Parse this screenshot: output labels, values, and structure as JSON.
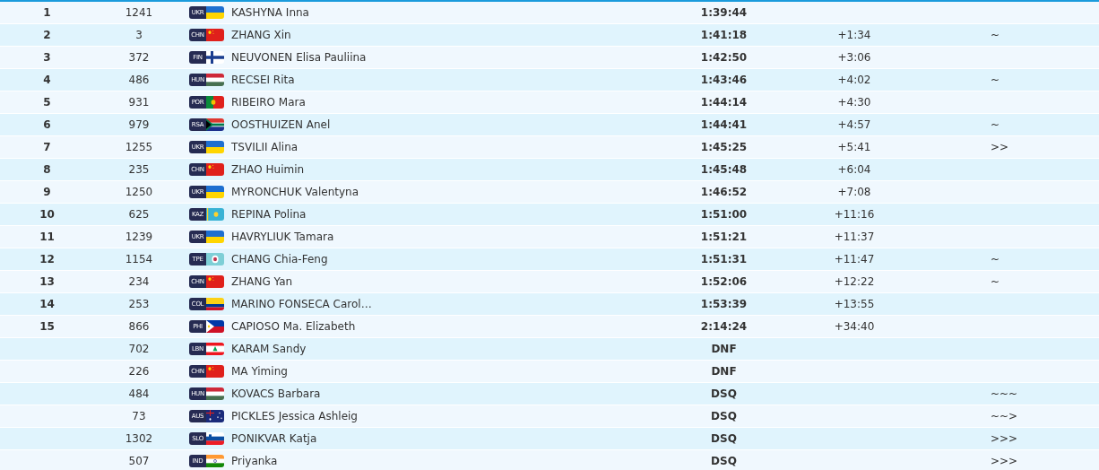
{
  "results": [
    {
      "rank": "1",
      "bib": "1241",
      "nation": "UKR",
      "kind": "ukr",
      "name": "KASHYNA Inna",
      "time": "1:39:44"
    },
    {
      "rank": "2",
      "bib": "3",
      "nation": "CHN",
      "kind": "chn",
      "name": "ZHANG Xin",
      "time": "1:41:18",
      "behind": "+1:34",
      "column_6": "~"
    },
    {
      "rank": "3",
      "bib": "372",
      "nation": "FIN",
      "kind": "fin",
      "name": "NEUVONEN Elisa Pauliina",
      "time": "1:42:50",
      "behind": "+3:06"
    },
    {
      "rank": "4",
      "bib": "486",
      "nation": "HUN",
      "kind": "hun",
      "name": "RECSEI Rita",
      "time": "1:43:46",
      "behind": "+4:02",
      "column_6": "~"
    },
    {
      "rank": "5",
      "bib": "931",
      "nation": "POR",
      "kind": "por",
      "name": "RIBEIRO Mara",
      "time": "1:44:14",
      "behind": "+4:30"
    },
    {
      "rank": "6",
      "bib": "979",
      "nation": "RSA",
      "kind": "rsa",
      "name": "OOSTHUIZEN Anel",
      "time": "1:44:41",
      "behind": "+4:57",
      "column_6": "~"
    },
    {
      "rank": "7",
      "bib": "1255",
      "nation": "UKR",
      "kind": "ukr",
      "name": "TSVILII Alina",
      "time": "1:45:25",
      "behind": "+5:41",
      "column_6": ">>"
    },
    {
      "rank": "8",
      "bib": "235",
      "nation": "CHN",
      "kind": "chn",
      "name": "ZHAO Huimin",
      "time": "1:45:48",
      "behind": "+6:04"
    },
    {
      "rank": "9",
      "bib": "1250",
      "nation": "UKR",
      "kind": "ukr",
      "name": "MYRONCHUK Valentyna",
      "time": "1:46:52",
      "behind": "+7:08"
    },
    {
      "rank": "10",
      "bib": "625",
      "nation": "KAZ",
      "kind": "kaz",
      "name": "REPINA Polina",
      "time": "1:51:00",
      "behind": "+11:16"
    },
    {
      "rank": "11",
      "bib": "1239",
      "nation": "UKR",
      "kind": "ukr",
      "name": "HAVRYLIUK Tamara",
      "time": "1:51:21",
      "behind": "+11:37"
    },
    {
      "rank": "12",
      "bib": "1154",
      "nation": "TPE",
      "kind": "tpe",
      "name": "CHANG Chia-Feng",
      "time": "1:51:31",
      "behind": "+11:47",
      "column_6": "~"
    },
    {
      "rank": "13",
      "bib": "234",
      "nation": "CHN",
      "kind": "chn",
      "name": "ZHANG Yan",
      "time": "1:52:06",
      "behind": "+12:22",
      "column_6": "~"
    },
    {
      "rank": "14",
      "bib": "253",
      "nation": "COL",
      "kind": "col",
      "name": "MARINO FONSECA Carol…",
      "time": "1:53:39",
      "behind": "+13:55"
    },
    {
      "rank": "15",
      "bib": "866",
      "nation": "PHI",
      "kind": "phi",
      "name": "CAPIOSO Ma. Elizabeth",
      "time": "2:14:24",
      "behind": "+34:40"
    },
    {
      "bib": "702",
      "nation": "LBN",
      "kind": "lbn",
      "name": "KARAM Sandy",
      "time": "DNF"
    },
    {
      "bib": "226",
      "nation": "CHN",
      "kind": "chn",
      "name": "MA Yiming",
      "time": "DNF"
    },
    {
      "bib": "484",
      "nation": "HUN",
      "kind": "hun",
      "name": "KOVACS Barbara",
      "time": "DSQ",
      "column_6": "~~~"
    },
    {
      "bib": "73",
      "nation": "AUS",
      "kind": "aus",
      "name": "PICKLES Jessica Ashleig",
      "time": "DSQ",
      "column_6": "~~>"
    },
    {
      "bib": "1302",
      "nation": "SLO",
      "kind": "slo",
      "name": "PONIKVAR Katja",
      "time": "DSQ",
      "column_6": ">>>"
    },
    {
      "bib": "507",
      "nation": "IND",
      "kind": "ind",
      "name": "Priyanka",
      "time": "DSQ",
      "column_6": ">>>"
    }
  ]
}
